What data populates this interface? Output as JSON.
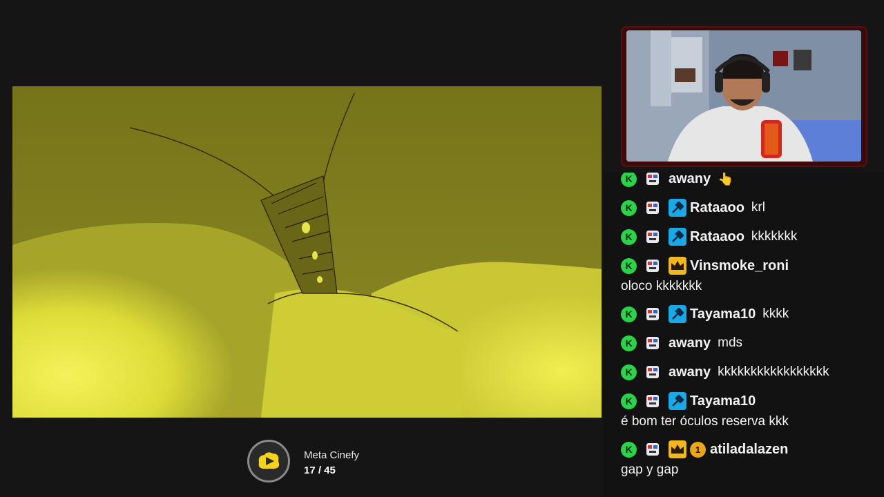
{
  "goal": {
    "title": "Meta Cinefy",
    "progress": "17 / 45",
    "current": 17,
    "total": 45,
    "icon": "cinefy-logo-icon"
  },
  "colors": {
    "background": "#151515",
    "chat_background": "#121212",
    "video_yellow": "#d9dc3a",
    "k_badge": "#2bd24a",
    "mod_badge": "#1aa9e8",
    "sub_badge": "#f0b71e",
    "cam_border": "#5a1010"
  },
  "chat": {
    "messages": [
      {
        "username": "awany",
        "text": "👆",
        "badges": [
          "k-badge",
          "face-badge"
        ]
      },
      {
        "username": "Rataaoo",
        "text": "krl",
        "badges": [
          "k-badge",
          "face-badge",
          "mod-badge"
        ]
      },
      {
        "username": "Rataaoo",
        "text": "kkkkkkk",
        "badges": [
          "k-badge",
          "face-badge",
          "mod-badge"
        ]
      },
      {
        "username": "Vinsmoke_roni",
        "text": "oloco kkkkkkk",
        "badges": [
          "k-badge",
          "face-badge",
          "crown-badge"
        ]
      },
      {
        "username": "Tayama10",
        "text": "kkkk",
        "badges": [
          "k-badge",
          "face-badge",
          "mod-badge"
        ]
      },
      {
        "username": "awany",
        "text": "mds",
        "badges": [
          "k-badge",
          "face-badge"
        ]
      },
      {
        "username": "awany",
        "text": "kkkkkkkkkkkkkkkkk",
        "badges": [
          "k-badge",
          "face-badge"
        ]
      },
      {
        "username": "Tayama10",
        "text": "é bom ter óculos reserva kkk",
        "badges": [
          "k-badge",
          "face-badge",
          "mod-badge"
        ]
      },
      {
        "username": "atiladalazen",
        "text": "gap y gap",
        "badges": [
          "k-badge",
          "face-badge",
          "crown-badge",
          "tier-badge"
        ],
        "tier": "1"
      }
    ]
  }
}
